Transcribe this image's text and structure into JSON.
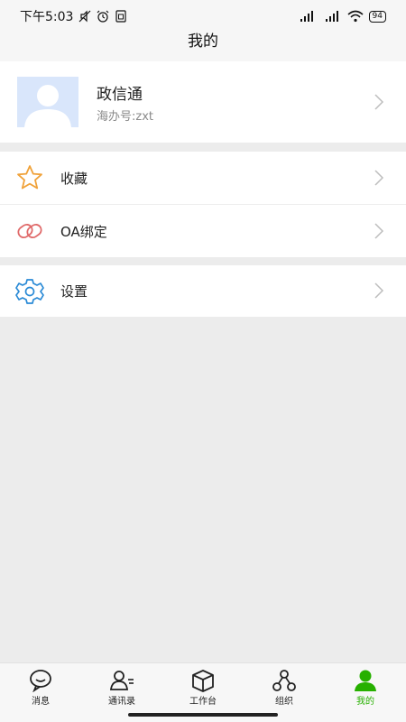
{
  "status_bar": {
    "time": "下午5:03",
    "battery": "94"
  },
  "header": {
    "title": "我的"
  },
  "profile": {
    "name": "政信通",
    "account": "海办号:zxt"
  },
  "menu": {
    "favorites": "收藏",
    "oa_bind": "OA绑定",
    "settings": "设置"
  },
  "tabbar": {
    "items": [
      {
        "label": "消息",
        "icon": "chat-bubble-icon"
      },
      {
        "label": "通讯录",
        "icon": "contacts-icon"
      },
      {
        "label": "工作台",
        "icon": "workbench-box-icon"
      },
      {
        "label": "组织",
        "icon": "organization-icon"
      },
      {
        "label": "我的",
        "icon": "person-icon",
        "active": true
      }
    ]
  },
  "colors": {
    "accent_green": "#27b000",
    "star_orange": "#f0a23a",
    "link_red": "#e06a6a",
    "gear_blue": "#2a8ad6",
    "avatar_bg": "#d9e6fb"
  }
}
